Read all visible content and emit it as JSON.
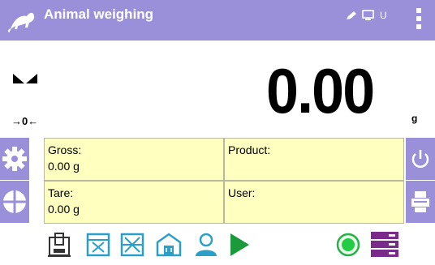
{
  "header": {
    "title": "Animal weighing",
    "app_icon": "rat-icon",
    "status_icons": [
      "edit-pen-icon",
      "monitor-icon"
    ],
    "status_text": "U",
    "menu_icon": "vertical-dots-menu-icon"
  },
  "display": {
    "mass": "0.00",
    "unit": "g",
    "zero_indicator": "→0←"
  },
  "info": {
    "gross_label": "Gross:",
    "gross_value": "0.00 g",
    "product_label": "Product:",
    "product_value": "",
    "tare_label": "Tare:",
    "tare_value": "0.00 g",
    "user_label": "User:",
    "user_value": ""
  },
  "side_left": [
    "settings-gear-icon",
    "profile-pie-icon",
    "tare-T-icon"
  ],
  "side_right": [
    "power-icon",
    "print-icon",
    "zero-icon"
  ],
  "bottom_icons": [
    "weigh-container-icon",
    "template-x-icon",
    "template-x2-icon",
    "home-load-icon",
    "user-icon",
    "start-play-icon",
    "record-icon",
    "database-icon"
  ],
  "colors": {
    "header_bg": "#9a8fd9",
    "cell_bg": "#ffffc0",
    "accent_blue": "#2aa0c8",
    "play_green": "#1a9a3a",
    "purple": "#7a2a8a"
  }
}
